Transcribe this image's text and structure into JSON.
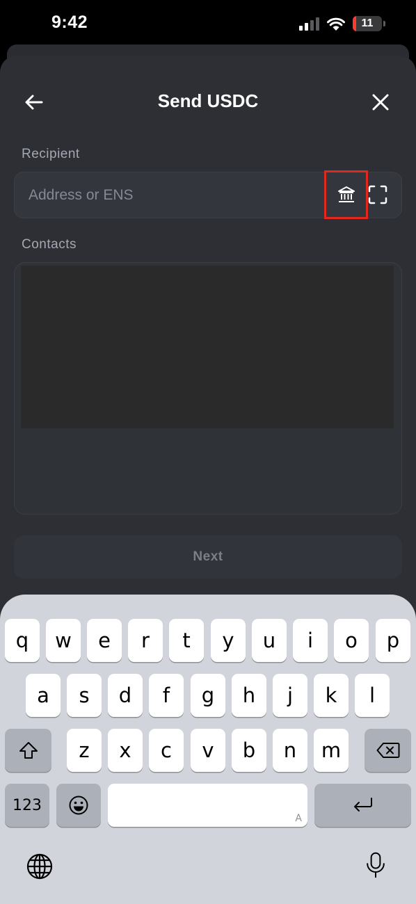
{
  "status_bar": {
    "time": "9:42",
    "battery_level": "11"
  },
  "header": {
    "title": "Send USDC"
  },
  "recipient": {
    "label": "Recipient",
    "placeholder": "Address or ENS"
  },
  "contacts": {
    "label": "Contacts"
  },
  "next_button": {
    "label": "Next"
  },
  "keyboard": {
    "row1": [
      "q",
      "w",
      "e",
      "r",
      "t",
      "y",
      "u",
      "i",
      "o",
      "p"
    ],
    "row2": [
      "a",
      "s",
      "d",
      "f",
      "g",
      "h",
      "j",
      "k",
      "l"
    ],
    "row3": [
      "z",
      "x",
      "c",
      "v",
      "b",
      "n",
      "m"
    ],
    "numbers_key": "123",
    "space_corner": "A"
  },
  "colors": {
    "sheet_bg": "#2d2f35",
    "highlight_box": "#e0281f",
    "keyboard_bg": "#d1d4db"
  }
}
